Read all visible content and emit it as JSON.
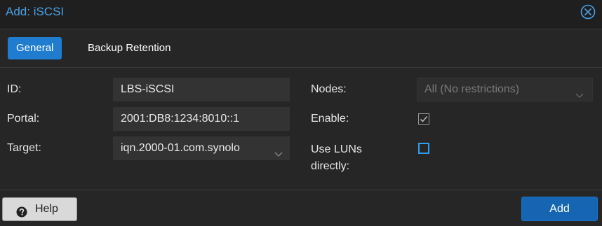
{
  "dialog": {
    "title": "Add: iSCSI",
    "colors": {
      "title": "#4aa3e6",
      "accent": "#1f7ccf",
      "primary_button": "#1565b3",
      "checkbox_border": "#2f9ef0"
    }
  },
  "tabs": [
    {
      "label": "General",
      "active": true
    },
    {
      "label": "Backup Retention",
      "active": false
    }
  ],
  "form": {
    "id": {
      "label": "ID:",
      "value": "LBS-iSCSI"
    },
    "portal": {
      "label": "Portal:",
      "value": "2001:DB8:1234:8010::1"
    },
    "target": {
      "label": "Target:",
      "value": "iqn.2000-01.com.synolo"
    },
    "nodes": {
      "label": "Nodes:",
      "value": "All (No restrictions)"
    },
    "enable": {
      "label": "Enable:",
      "checked": true
    },
    "use_luns": {
      "label_line1": "Use LUNs",
      "label_line2": "directly:",
      "checked": false
    }
  },
  "footer": {
    "help_label": "Help",
    "add_label": "Add"
  }
}
